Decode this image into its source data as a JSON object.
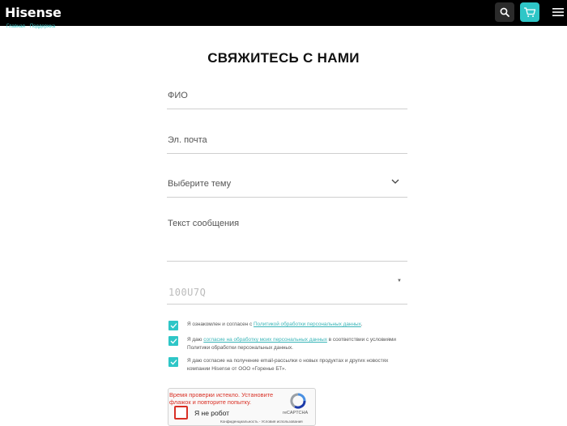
{
  "header": {
    "logo": "Hisense",
    "icons": {
      "search": "search-icon",
      "cart": "cart-icon",
      "menu": "hamburger-menu-icon"
    },
    "accent_color": "#2ec6c7",
    "background_color": "#000000"
  },
  "breadcrumb": {
    "items": [
      "Главная",
      "Поддержка"
    ]
  },
  "page": {
    "title": "СВЯЖИТЕСЬ С НАМИ"
  },
  "form": {
    "name_label": "ФИО",
    "email_label": "Эл. почта",
    "topic_label": "Выберите тему",
    "message_label": "Текст сообщения",
    "captcha_code": "100U7Q",
    "checkboxes": [
      {
        "text_before": "Я ознакомлен и согласен с ",
        "link": "Политикой обработки персональных данных",
        "text_after": ".",
        "checked": true
      },
      {
        "text_before": "Я даю ",
        "link": "согласие на обработку моих персональных данных",
        "text_after": " в соответствии с условиями Политики обработки персональных данных.",
        "checked": true
      },
      {
        "text_before": "Я даю согласие на получение email-рассылки о новых продуктах и других новостях компании Hisense от ООО «Горенье БТ».",
        "link": "",
        "text_after": "",
        "checked": true
      }
    ]
  },
  "recaptcha": {
    "error": "Время проверки истекло. Установите флажок и повторите попытку.",
    "label": "Я не робот",
    "brand": "reCAPTCHA",
    "links": "Конфиденциальность - Условия использования",
    "error_color": "#d93025"
  }
}
